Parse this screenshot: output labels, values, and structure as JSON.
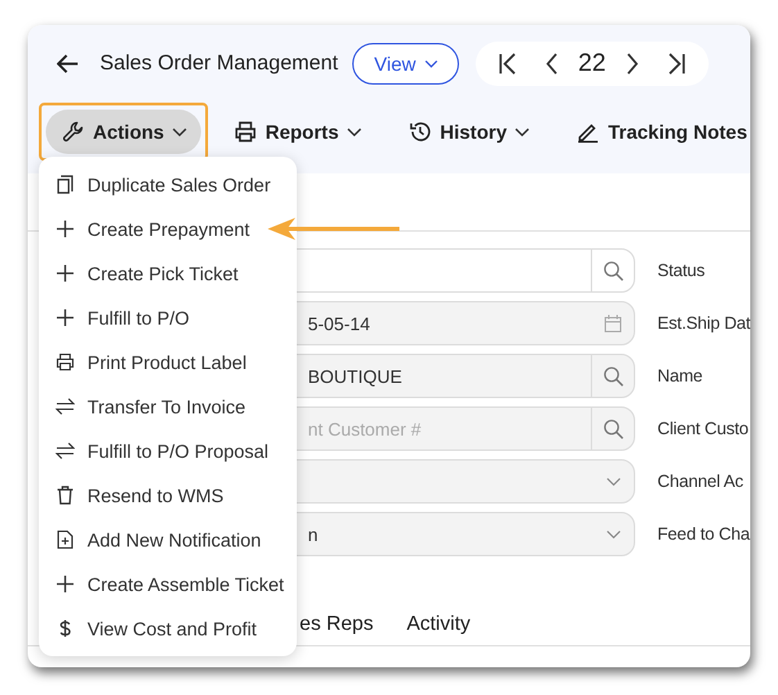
{
  "window": {
    "title": "Sales Order Management"
  },
  "view_button": {
    "label": "View"
  },
  "pager": {
    "current": "22"
  },
  "toolbar": [
    {
      "label": "Actions",
      "kind": "wrench",
      "dropdown": true,
      "expanded": true,
      "highlighted": true
    },
    {
      "label": "Reports",
      "kind": "print",
      "dropdown": true,
      "expanded": false,
      "highlighted": false
    },
    {
      "label": "History",
      "kind": "history",
      "dropdown": true,
      "expanded": false,
      "highlighted": false
    },
    {
      "label": "Tracking Notes",
      "kind": "pen",
      "dropdown": false,
      "expanded": false,
      "highlighted": false
    }
  ],
  "actions_menu": [
    {
      "label": "Duplicate Sales Order",
      "kind": "duplicate",
      "pointed": false
    },
    {
      "label": "Create Prepayment",
      "kind": "create",
      "pointed": true
    },
    {
      "label": "Create Pick Ticket",
      "kind": "create",
      "pointed": false
    },
    {
      "label": "Fulfill to P/O",
      "kind": "create",
      "pointed": false
    },
    {
      "label": "Print Product Label",
      "kind": "print",
      "pointed": false
    },
    {
      "label": "Transfer To Invoice",
      "kind": "transfer",
      "pointed": false
    },
    {
      "label": "Fulfill to P/O Proposal",
      "kind": "transfer",
      "pointed": false
    },
    {
      "label": "Resend to WMS",
      "kind": "delete",
      "pointed": false
    },
    {
      "label": "Add New Notification",
      "kind": "notify",
      "pointed": false
    },
    {
      "label": "Create Assemble Ticket",
      "kind": "create",
      "pointed": false
    },
    {
      "label": "View Cost and Profit",
      "kind": "cost",
      "pointed": false
    }
  ],
  "fields": [
    {
      "kind": "search",
      "disabled": false,
      "label": "Status"
    },
    {
      "kind": "date",
      "disabled": true,
      "value": "5-05-14",
      "label": "Est.Ship Dat"
    },
    {
      "kind": "search",
      "disabled": true,
      "value": "BOUTIQUE",
      "label": "Name"
    },
    {
      "kind": "search",
      "disabled": true,
      "placeholder": "nt Customer #",
      "label": "Client Custo"
    },
    {
      "kind": "dropdown",
      "disabled": true,
      "label": "Channel Ac"
    },
    {
      "kind": "dropdown",
      "disabled": true,
      "value": "n",
      "label": "Feed to Cha"
    }
  ],
  "tabs": [
    {
      "label": "es Reps"
    },
    {
      "label": "Activity"
    }
  ]
}
